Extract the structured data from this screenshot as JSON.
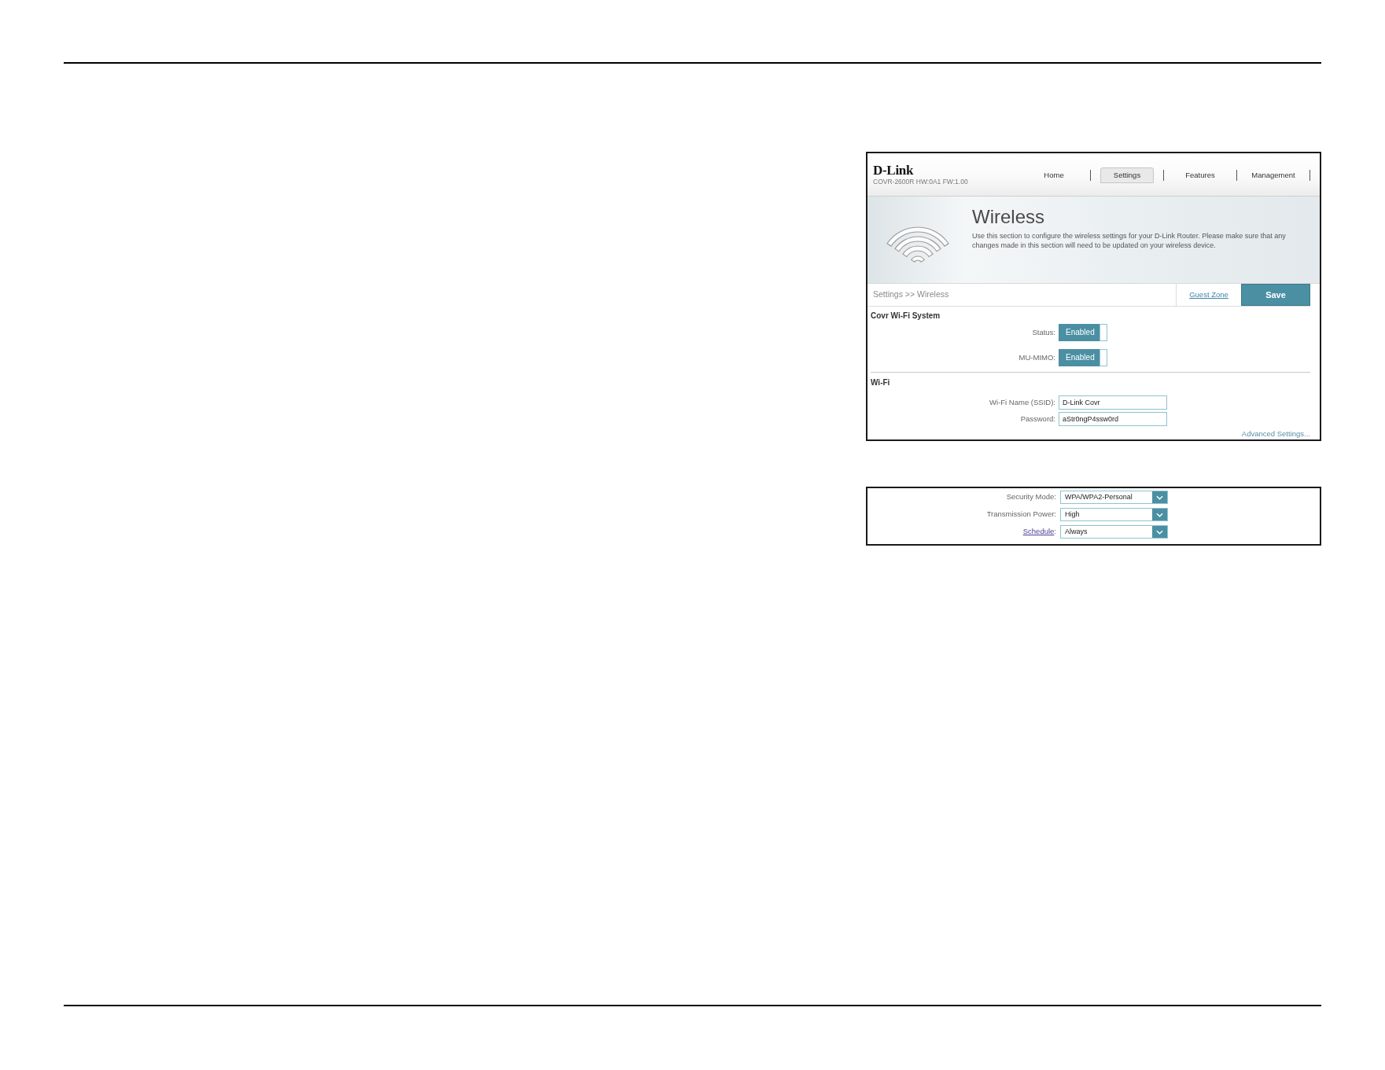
{
  "main_screenshot": {
    "header": {
      "logo": "D-Link",
      "device_info": "COVR-2600R HW:0A1 FW:1.00",
      "nav": [
        {
          "label": "Home",
          "selected": false
        },
        {
          "label": "Settings",
          "selected": true
        },
        {
          "label": "Features",
          "selected": false
        },
        {
          "label": "Management",
          "selected": false
        }
      ]
    },
    "banner": {
      "title": "Wireless",
      "description": "Use this section to configure the wireless settings for your D-Link Router. Please make sure that any changes made in this section will need to be updated on your wireless device."
    },
    "toolbar": {
      "breadcrumb": "Settings >> Wireless",
      "link": "Guest Zone",
      "save_button": "Save"
    },
    "sections": [
      {
        "title": "Covr Wi-Fi System",
        "fields": [
          {
            "kind": "toggle",
            "label": "Status:",
            "value": "Enabled",
            "on": true
          },
          {
            "kind": "toggle",
            "label": "MU-MIMO:",
            "value": "Enabled",
            "on": true
          }
        ]
      },
      {
        "title": "Wi-Fi",
        "fields": [
          {
            "kind": "text",
            "label": "Wi-Fi Name (SSID):",
            "value": "D-Link Covr"
          },
          {
            "kind": "text",
            "label": "Password:",
            "value": "aStr0ngP4ssw0rd"
          }
        ]
      }
    ],
    "advanced_link": "Advanced Settings..."
  },
  "advanced_screenshot": {
    "fields": [
      {
        "kind": "select",
        "label": "Security Mode:",
        "link": false,
        "value": "WPA/WPA2-Personal"
      },
      {
        "kind": "select",
        "label": "Transmission Power:",
        "link": false,
        "value": "High"
      },
      {
        "kind": "select",
        "label": "Schedule",
        "suffix": ":",
        "link": true,
        "value": "Always"
      }
    ]
  }
}
